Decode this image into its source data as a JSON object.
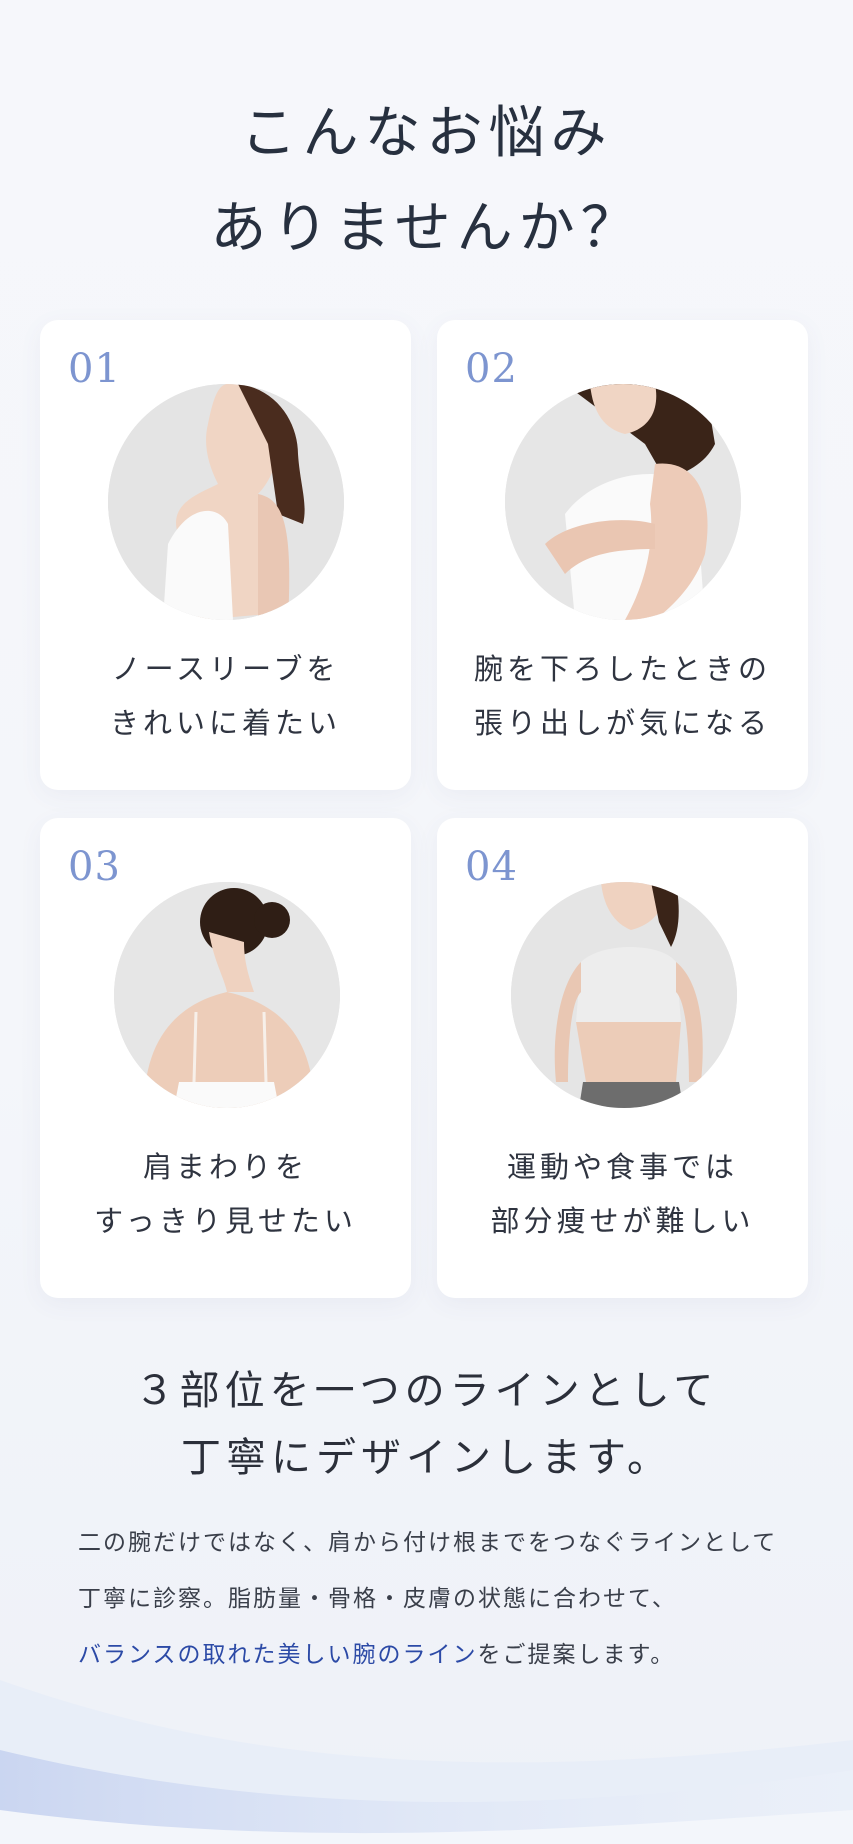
{
  "heading": {
    "line1": "こんなお悩み",
    "line2": "ありませんか？"
  },
  "cards": [
    {
      "number": "01",
      "caption1": "ノースリーブを",
      "caption2": "きれいに着たい",
      "icon": "woman-side-profile-icon"
    },
    {
      "number": "02",
      "caption1": "腕を下ろしたときの",
      "caption2": "張り出しが気になる",
      "icon": "woman-holding-arm-icon"
    },
    {
      "number": "03",
      "caption1": "肩まわりを",
      "caption2": "すっきり見せたい",
      "icon": "woman-back-shoulders-icon"
    },
    {
      "number": "04",
      "caption1": "運動や食事では",
      "caption2": "部分痩せが難しい",
      "icon": "woman-front-sports-bra-icon"
    }
  ],
  "subheading": {
    "line1": "３部位を一つのラインとして",
    "line2": "丁寧にデザインします。"
  },
  "body": {
    "line1": "二の腕だけではなく、肩から付け根までをつなぐラインとして",
    "line2": "丁寧に診察。脂肪量・骨格・皮膚の状態に合わせて、",
    "line3_highlight": "バランスの取れた美しい腕のライン",
    "line3_rest": "をご提案します。"
  },
  "colors": {
    "accent_number": "#7d95d0",
    "highlight": "#2c4aa6",
    "wave": "#c9d5f0"
  }
}
